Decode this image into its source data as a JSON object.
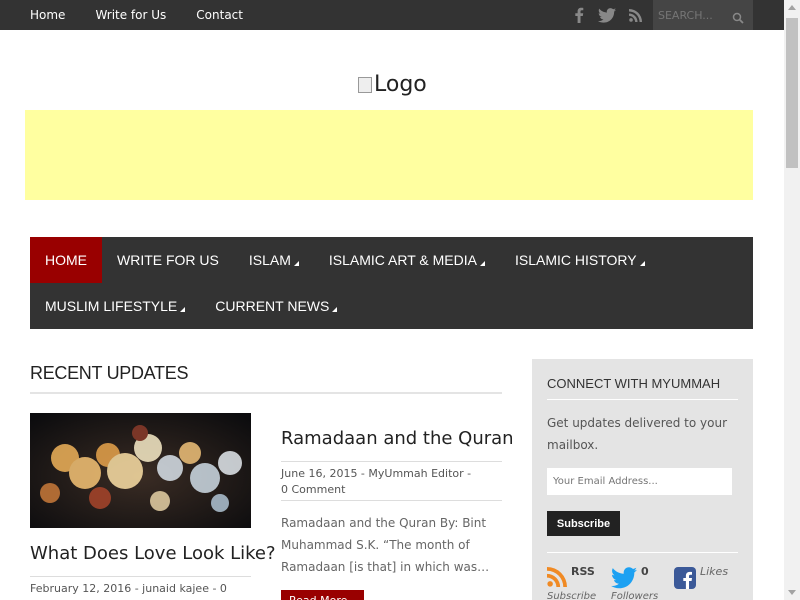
{
  "topnav": {
    "items": [
      "Home",
      "Write for Us",
      "Contact"
    ]
  },
  "social_icons": [
    "facebook-icon",
    "twitter-icon",
    "rss-icon"
  ],
  "search": {
    "placeholder": "SEARCH..."
  },
  "logo": {
    "alt": "Logo"
  },
  "mainnav": {
    "row1": [
      {
        "label": "HOME",
        "active": true,
        "has_sub": false
      },
      {
        "label": "WRITE FOR US",
        "active": false,
        "has_sub": false
      },
      {
        "label": "ISLAM",
        "active": false,
        "has_sub": true
      },
      {
        "label": "ISLAMIC ART & MEDIA",
        "active": false,
        "has_sub": true
      },
      {
        "label": "ISLAMIC HISTORY",
        "active": false,
        "has_sub": true
      }
    ],
    "row2": [
      {
        "label": "MUSLIM LIFESTYLE",
        "active": false,
        "has_sub": true
      },
      {
        "label": "CURRENT NEWS",
        "active": false,
        "has_sub": true
      }
    ]
  },
  "recent": {
    "title": "RECENT UPDATES",
    "post1": {
      "title": "What Does Love Look Like?",
      "meta": "February 12, 2016 - junaid kajee - 0"
    },
    "post2": {
      "title": "Ramadaan and the Quran",
      "meta": "June 16, 2015 - MyUmmah Editor - 0 Comment",
      "excerpt": "Ramadaan and the Quran By: Bint Muhammad S.K. “The month of Ramadaan [is that] in which was…",
      "read_more": "Read More"
    }
  },
  "sidebar": {
    "title": "CONNECT WITH MYUMMAH",
    "desc": "Get updates delivered to your mailbox.",
    "email_placeholder": "Your Email Address...",
    "subscribe": "Subscribe",
    "rss": {
      "count": "RSS",
      "label": "Subscribe"
    },
    "twitter": {
      "count": "0",
      "label": "Followers"
    },
    "facebook": {
      "count": "Likes",
      "label": ""
    }
  },
  "colors": {
    "topbar": "#333333",
    "accent": "#990000",
    "banner": "#ffffa0",
    "sidebar_bg": "#e4e4e4"
  }
}
